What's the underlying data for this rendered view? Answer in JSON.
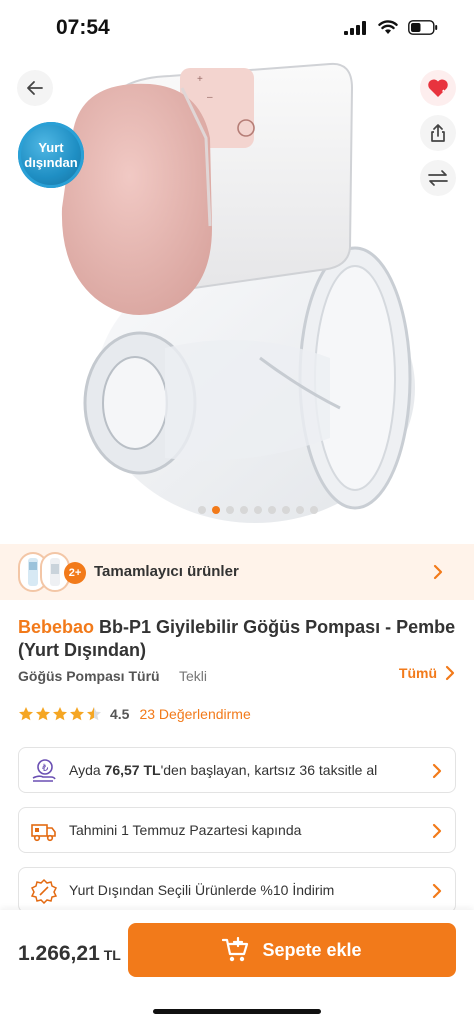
{
  "status_bar": {
    "time": "07:54",
    "battery_level": 0.45
  },
  "hero": {
    "badge": {
      "line1": "Yurt",
      "line2": "dışından"
    },
    "icons": [
      "back-arrow-icon",
      "heart-icon",
      "share-icon",
      "compare-icon"
    ],
    "image_count": 9,
    "active_image": 1
  },
  "complement": {
    "label": "Tamamlayıcı ürünler",
    "badge": "2+"
  },
  "product": {
    "brand": "Bebebao",
    "name": "Bb-P1 Giyilebilir Göğüs Pompası - Pembe (Yurt Dışından)"
  },
  "variant": {
    "label": "Göğüs Pompası Türü",
    "value": "Tekli",
    "all_label": "Tümü"
  },
  "rating": {
    "value": "4.5",
    "stars": 4.5,
    "count_label": "23 Değerlendirme"
  },
  "cards": {
    "installment": {
      "prefix": "Ayda ",
      "amount": "76,57 TL",
      "suffix": "'den başlayan, kartsız 36 taksitle al"
    },
    "delivery": {
      "text": "Tahmini 1 Temmuz Pazartesi kapında"
    },
    "discount": {
      "text": "Yurt Dışından Seçili Ürünlerde %10 İndirim"
    }
  },
  "bottom": {
    "price": "1.266,21",
    "currency": "TL",
    "cart_label": "Sepete ekle"
  },
  "colors": {
    "accent": "#f27a1a",
    "complement_bg": "#fff3ea"
  }
}
